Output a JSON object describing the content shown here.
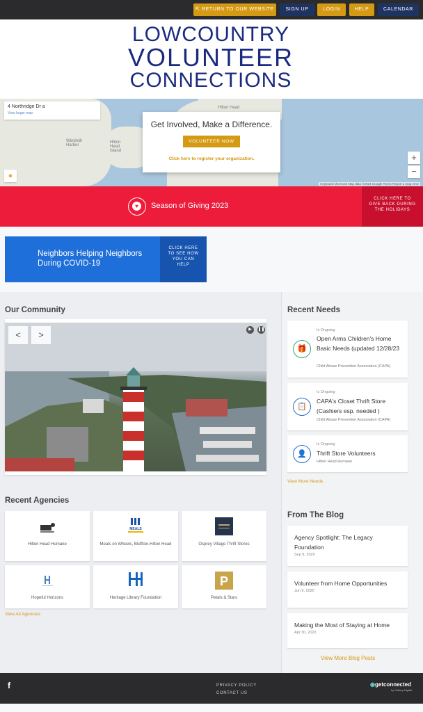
{
  "topbar": {
    "return_label": "Return to Our Website",
    "signup_label": "Sign Up",
    "login_label": "Login",
    "help_label": "Help",
    "calendar_label": "Calendar"
  },
  "logo": {
    "line1": "LOWCOUNTRY",
    "line2": "VOLUNTEER",
    "line3": "CONNECTIONS"
  },
  "map": {
    "address": "4 Northridge Dr a",
    "view_larger": "View larger map",
    "labels": [
      "Hilton Head",
      "Windmill Harbor",
      "Hilton Head Island"
    ],
    "footer": "Keyboard shortcuts   Map data ©2024 Google   Terms   Report a map error",
    "zoom_in": "+",
    "zoom_out": "−"
  },
  "involved": {
    "title": "Get Involved, Make a Difference.",
    "button": "Volunteer Now",
    "register_link": "Click here to register your organization."
  },
  "giving": {
    "title": "Season of Giving 2023",
    "cta": "Click here to give back during the holidays"
  },
  "neighbors": {
    "title": "Neighbors Helping Neighbors During COVID-19",
    "cta": "Click here to see how you can help"
  },
  "community": {
    "title": "Our Community",
    "prev": "<",
    "next": ">"
  },
  "needs": {
    "title": "Recent Needs",
    "items": [
      {
        "tag": "Is Ongoing",
        "title": "Open Arms Children's Home Basic Needs (updated 12/28/23",
        "org": "Child Abuse Prevention Association (CAPA)",
        "icon": "gift-icon"
      },
      {
        "tag": "Is Ongoing",
        "title": "CAPA's Closet Thrift Store (Cashiers esp. needed )",
        "org": "Child Abuse Prevention Association (CAPA)",
        "icon": "clipboard-icon"
      },
      {
        "tag": "Is Ongoing",
        "title": "Thrift Store Volunteers",
        "org": "Hilton Head Humane",
        "icon": "user-heart-icon"
      }
    ],
    "view_more": "View More Needs"
  },
  "agencies": {
    "title": "Recent Agencies",
    "items": [
      {
        "name": "Hilton Head Humane"
      },
      {
        "name": "Meals on Wheels, Bluffton-Hilton Head"
      },
      {
        "name": "Osprey Village Thrift Stores"
      },
      {
        "name": "Hopeful Horizons"
      },
      {
        "name": "Heritage Library Foundation"
      },
      {
        "name": "Petals & Stars"
      }
    ],
    "logo_text": {
      "meals": "MEALS",
      "petals": "P"
    },
    "view_all": "View All Agencies"
  },
  "blog": {
    "title": "From The Blog",
    "items": [
      {
        "title": "Agency Spotlight: The Legacy Foundation",
        "date": "Sep 8, 2020"
      },
      {
        "title": "Volunteer from Home Opportunities",
        "date": "Jun 9, 2020"
      },
      {
        "title": "Making the Most of Staying at Home",
        "date": "Apr 30, 2020"
      }
    ],
    "view_more": "View More Blog Posts"
  },
  "footer": {
    "facebook": "f",
    "privacy": "Privacy Policy",
    "contact": "Contact Us",
    "brand": "getconnected",
    "brand_sub": "by Galaxy Digital"
  },
  "colors": {
    "gold": "#d49a14",
    "navy": "#1f3360",
    "red": "#ee1c3b",
    "blue": "#1e6fd9",
    "logo_blue": "#1b2a80"
  }
}
